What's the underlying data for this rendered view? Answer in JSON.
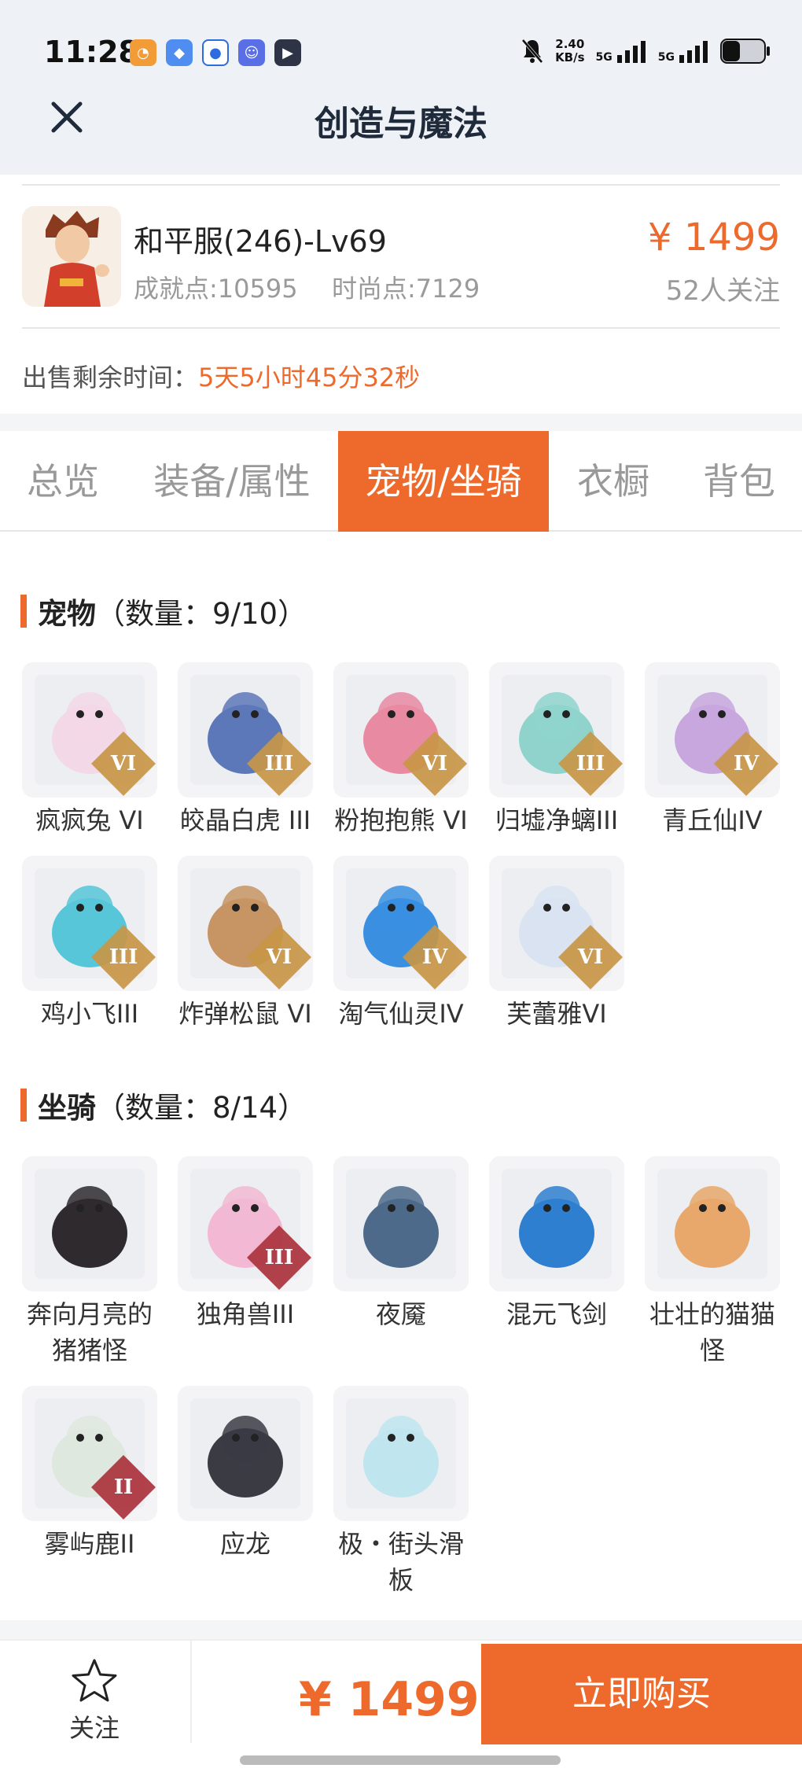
{
  "status_bar": {
    "time": "11:28",
    "speed_value": "2.40",
    "speed_unit": "KB/s",
    "signal_1": "5G",
    "signal_2": "5G",
    "apps": [
      "taobao-app-icon",
      "blue-app-icon",
      "circle-app-icon",
      "mascot-app-icon",
      "play-app-icon"
    ]
  },
  "header": {
    "title": "创造与魔法"
  },
  "character": {
    "name": "和平服(246)-Lv69",
    "achievement": "成就点:10595",
    "fashion": "时尚点:7129",
    "price": "¥ 1499",
    "followers": "52人关注"
  },
  "sale": {
    "label": "出售剩余时间：",
    "remaining": "5天5小时45分32秒"
  },
  "tabs": [
    {
      "label": "总览",
      "active": false
    },
    {
      "label": "装备/属性",
      "active": false
    },
    {
      "label": "宠物/坐骑",
      "active": true
    },
    {
      "label": "衣橱",
      "active": false
    },
    {
      "label": "背包",
      "active": false
    }
  ],
  "pets": {
    "title": "宠物",
    "count": "（数量：9/10）",
    "items": [
      {
        "name": "疯疯兔 VI",
        "rank": "VI",
        "color": "#f3d8e8"
      },
      {
        "name": "皎晶白虎 III",
        "rank": "III",
        "color": "#5d78b8"
      },
      {
        "name": "粉抱抱熊 VI",
        "rank": "VI",
        "color": "#e98aa3"
      },
      {
        "name": "归墟净螭III",
        "rank": "III",
        "color": "#8fd3cc"
      },
      {
        "name": "青丘仙IV",
        "rank": "IV",
        "color": "#c8a6de"
      },
      {
        "name": "鸡小飞III",
        "rank": "III",
        "color": "#57c6d8"
      },
      {
        "name": "炸弹松鼠 VI",
        "rank": "VI",
        "color": "#c79463"
      },
      {
        "name": "淘气仙灵IV",
        "rank": "IV",
        "color": "#3a8fe0"
      },
      {
        "name": "芙蕾雅VI",
        "rank": "VI",
        "color": "#d9e3f2"
      }
    ]
  },
  "mounts": {
    "title": "坐骑",
    "count": "（数量：8/14）",
    "items": [
      {
        "name": "奔向月亮的猪猪怪",
        "rank": "",
        "color": "#2e2a2e"
      },
      {
        "name": "独角兽III",
        "rank": "III",
        "color": "#f2b8d4"
      },
      {
        "name": "夜魇",
        "rank": "",
        "color": "#4e6a8a"
      },
      {
        "name": "混元飞剑",
        "rank": "",
        "color": "#2f7fd0"
      },
      {
        "name": "壮壮的猫猫怪",
        "rank": "",
        "color": "#e8a76b"
      },
      {
        "name": "雾屿鹿II",
        "rank": "II",
        "color": "#dfe8de"
      },
      {
        "name": "应龙",
        "rank": "",
        "color": "#3b3b44"
      },
      {
        "name": "极・街头滑板",
        "rank": "",
        "color": "#bfe5ef"
      }
    ]
  },
  "footer": {
    "follow_label": "关注",
    "price": "¥ 1499",
    "buy_label": "立即购买"
  }
}
